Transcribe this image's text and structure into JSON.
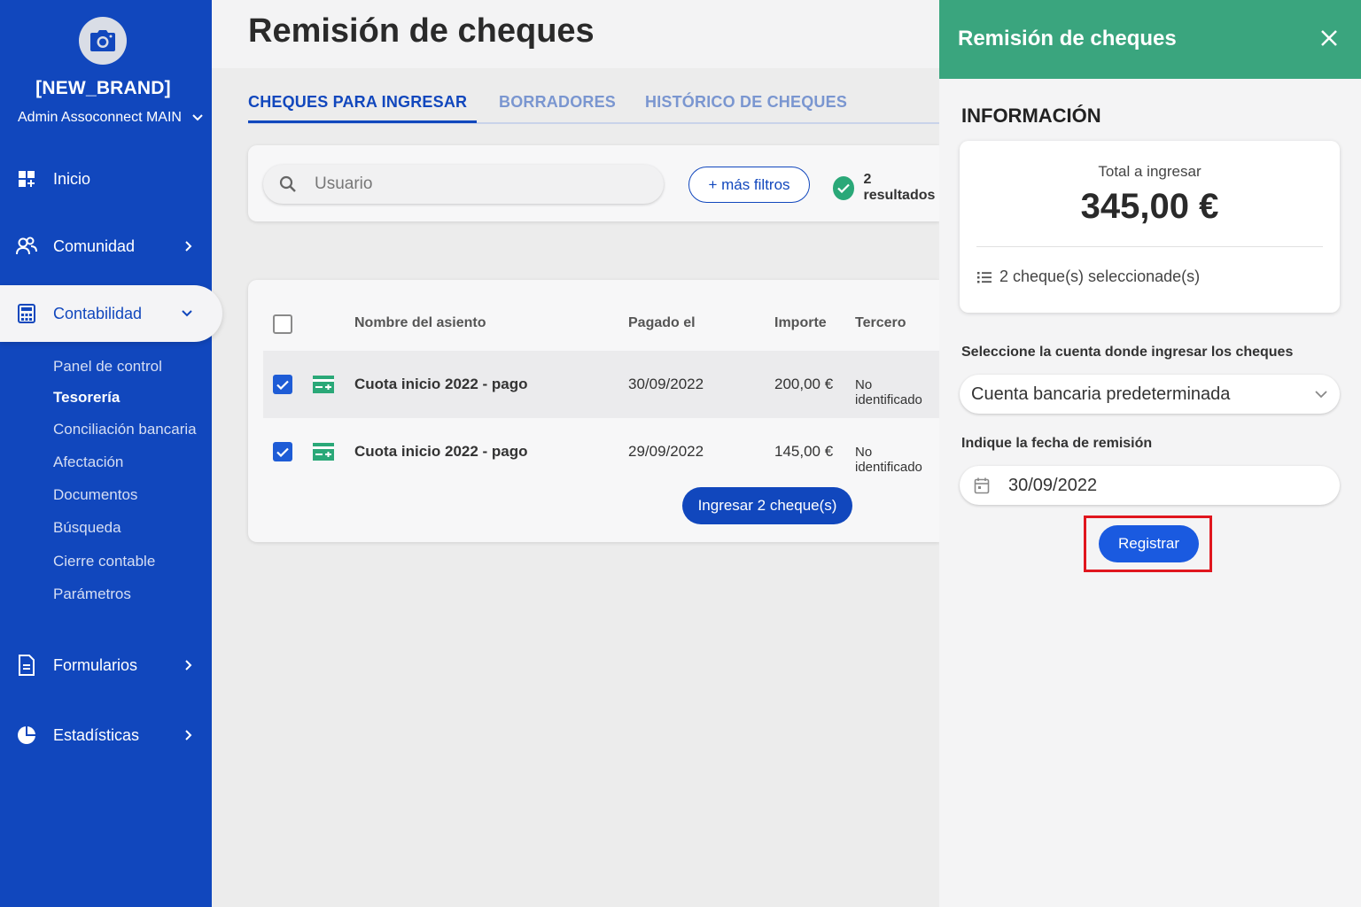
{
  "sidebar": {
    "brand": "[NEW_BRAND]",
    "org": "Admin Assoconnect MAIN",
    "items": [
      {
        "label": "Inicio",
        "icon": "dashboard-icon"
      },
      {
        "label": "Comunidad",
        "icon": "people-icon"
      },
      {
        "label": "Contabilidad",
        "icon": "calculator-icon"
      },
      {
        "label": "Formularios",
        "icon": "document-icon"
      },
      {
        "label": "Estadísticas",
        "icon": "pie-chart-icon"
      }
    ],
    "subitems": [
      "Panel de control",
      "Tesorería",
      "Conciliación bancaria",
      "Afectación",
      "Documentos",
      "Búsqueda",
      "Cierre contable",
      "Parámetros"
    ]
  },
  "main": {
    "title": "Remisión de cheques",
    "tabs": [
      "CHEQUES PARA INGRESAR",
      "BORRADORES",
      "HISTÓRICO DE CHEQUES"
    ],
    "search_placeholder": "Usuario",
    "filters_label": "+ más filtros",
    "results_label": "2 resultados",
    "columns": [
      "Nombre del asiento",
      "Pagado el",
      "Importe",
      "Tercero"
    ],
    "rows": [
      {
        "name": "Cuota inicio 2022 - pago",
        "date": "30/09/2022",
        "amount": "200,00 €",
        "third": "No identificado",
        "checked": true
      },
      {
        "name": "Cuota inicio 2022 - pago",
        "date": "29/09/2022",
        "amount": "145,00 €",
        "third": "No identificado",
        "checked": true
      }
    ],
    "submit_label": "Ingresar 2 cheque(s)"
  },
  "panel": {
    "title": "Remisión de cheques",
    "section": "INFORMACIÓN",
    "total_label": "Total a ingresar",
    "total_value": "345,00 €",
    "selected_label": "2 cheque(s) seleccionade(s)",
    "account_label": "Seleccione la cuenta donde ingresar los cheques",
    "account_value": "Cuenta bancaria predeterminada",
    "date_label": "Indique la fecha de remisión",
    "date_value": "30/09/2022",
    "register_label": "Registrar"
  },
  "colors": {
    "sidebar": "#1147bd",
    "panel_header": "#3aa57e",
    "primary_button": "#1a5ae0",
    "highlight": "#e0161e"
  }
}
